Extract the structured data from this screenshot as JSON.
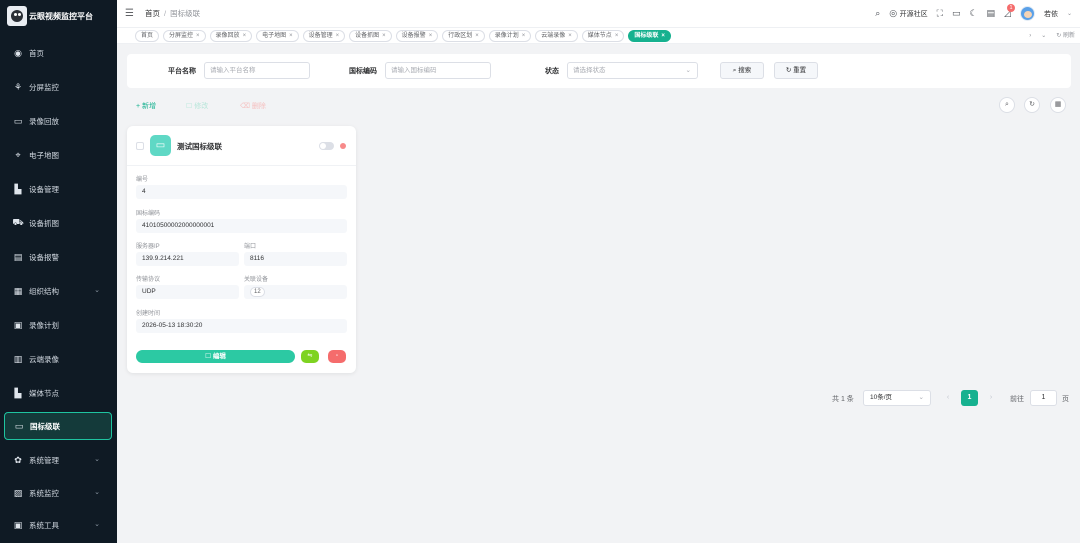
{
  "brand": {
    "title": "云眼视频监控平台"
  },
  "sidebar": {
    "items": [
      {
        "label": "首页",
        "icon": "dashboard-icon",
        "glyph": "◉",
        "expandable": false,
        "active": false
      },
      {
        "label": "分屏监控",
        "icon": "split-screen-icon",
        "glyph": "⚘",
        "expandable": false,
        "active": false
      },
      {
        "label": "录像回放",
        "icon": "playback-icon",
        "glyph": "▭",
        "expandable": false,
        "active": false
      },
      {
        "label": "电子地图",
        "icon": "map-icon",
        "glyph": "⌖",
        "expandable": false,
        "active": false
      },
      {
        "label": "设备管理",
        "icon": "device-icon",
        "glyph": "▙",
        "expandable": false,
        "active": false
      },
      {
        "label": "设备抓图",
        "icon": "cart-icon",
        "glyph": "⛟",
        "expandable": false,
        "active": false
      },
      {
        "label": "设备报警",
        "icon": "alarm-icon",
        "glyph": "▤",
        "expandable": false,
        "active": false
      },
      {
        "label": "组织结构",
        "icon": "org-icon",
        "glyph": "▦",
        "expandable": true,
        "active": false
      },
      {
        "label": "录像计划",
        "icon": "plan-icon",
        "glyph": "▣",
        "expandable": false,
        "active": false
      },
      {
        "label": "云端录像",
        "icon": "cloud-record-icon",
        "glyph": "▥",
        "expandable": false,
        "active": false
      },
      {
        "label": "媒体节点",
        "icon": "media-node-icon",
        "glyph": "▙",
        "expandable": false,
        "active": false
      },
      {
        "label": "国标级联",
        "icon": "cascade-icon",
        "glyph": "▭",
        "expandable": false,
        "active": true
      },
      {
        "label": "系统管理",
        "icon": "gear-icon",
        "glyph": "✿",
        "expandable": true,
        "active": false
      },
      {
        "label": "系统监控",
        "icon": "monitor-icon",
        "glyph": "▨",
        "expandable": true,
        "active": false
      },
      {
        "label": "系统工具",
        "icon": "toolbox-icon",
        "glyph": "▣",
        "expandable": true,
        "active": false
      }
    ]
  },
  "header": {
    "breadcrumb": [
      "首页",
      "国标级联"
    ],
    "community_label": "开源社区",
    "notification_count": "1",
    "user_name": "若依"
  },
  "tags": {
    "items": [
      {
        "label": "首页",
        "closable": false,
        "active": false
      },
      {
        "label": "分屏监控",
        "closable": true,
        "active": false
      },
      {
        "label": "录像回放",
        "closable": true,
        "active": false
      },
      {
        "label": "电子地图",
        "closable": true,
        "active": false
      },
      {
        "label": "设备管理",
        "closable": true,
        "active": false
      },
      {
        "label": "设备抓图",
        "closable": true,
        "active": false
      },
      {
        "label": "设备报警",
        "closable": true,
        "active": false
      },
      {
        "label": "行政区划",
        "closable": true,
        "active": false
      },
      {
        "label": "录像计划",
        "closable": true,
        "active": false
      },
      {
        "label": "云端录像",
        "closable": true,
        "active": false
      },
      {
        "label": "媒体节点",
        "closable": true,
        "active": false
      },
      {
        "label": "国标级联",
        "closable": true,
        "active": true
      }
    ],
    "refresh_label": "刷新"
  },
  "search": {
    "platform_name_label": "平台名称",
    "platform_name_placeholder": "请输入平台名称",
    "gb_code_label": "国标编码",
    "gb_code_placeholder": "请输入国标编码",
    "status_label": "状态",
    "status_placeholder": "请选择状态",
    "search_button": "搜索",
    "reset_button": "重置"
  },
  "toolbar": {
    "add_label": "+ 新增",
    "edit_label": "修改",
    "delete_label": "删除"
  },
  "card": {
    "title": "测试国标级联",
    "fields": {
      "id_label": "编号",
      "id_value": "4",
      "gb_code_label": "国标编码",
      "gb_code_value": "41010500002000000001",
      "server_ip_label": "服务器IP",
      "server_ip_value": "139.9.214.221",
      "port_label": "端口",
      "port_value": "8116",
      "protocol_label": "传输协议",
      "protocol_value": "UDP",
      "linked_devices_label": "关联设备",
      "linked_devices_value": "12",
      "created_label": "创建时间",
      "created_value": "2026-05-13 18:30:20"
    },
    "edit_button": "编辑"
  },
  "pagination": {
    "total_text": "共 1 条",
    "page_size": "10条/页",
    "current_page": "1",
    "goto_label": "前往",
    "goto_value": "1",
    "page_unit": "页"
  },
  "colors": {
    "accent": "#16b18f",
    "sidebar_bg": "#0f1a24",
    "danger": "#f56c6c",
    "success": "#7ed321"
  }
}
